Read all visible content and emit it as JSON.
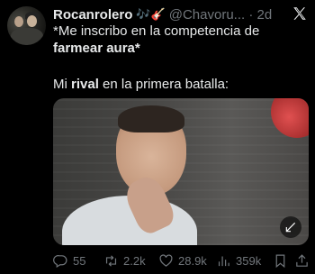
{
  "tweet": {
    "display_name": "Rocanrolero",
    "name_emojis": "🎶🎸",
    "handle_time": "@Chavoru... · 2d",
    "text_line1": "*Me inscribo en la competencia de",
    "text_line2": "farmear aura",
    "text_line2_suffix": "*",
    "text2_prefix": "Mi ",
    "text2_bold": "rival",
    "text2_suffix": " en la primera batalla:"
  },
  "actions": {
    "replies": "55",
    "reposts": "2.2k",
    "likes": "28.9k",
    "views": "359k"
  },
  "icons": {
    "logo": "x-logo-icon",
    "expand": "expand-icon",
    "reply": "reply-icon",
    "repost": "repost-icon",
    "like": "heart-icon",
    "views": "views-icon",
    "bookmark": "bookmark-icon",
    "share": "share-icon"
  },
  "colors": {
    "background": "#000000",
    "text": "#e7e9ea",
    "muted": "#71767b"
  }
}
